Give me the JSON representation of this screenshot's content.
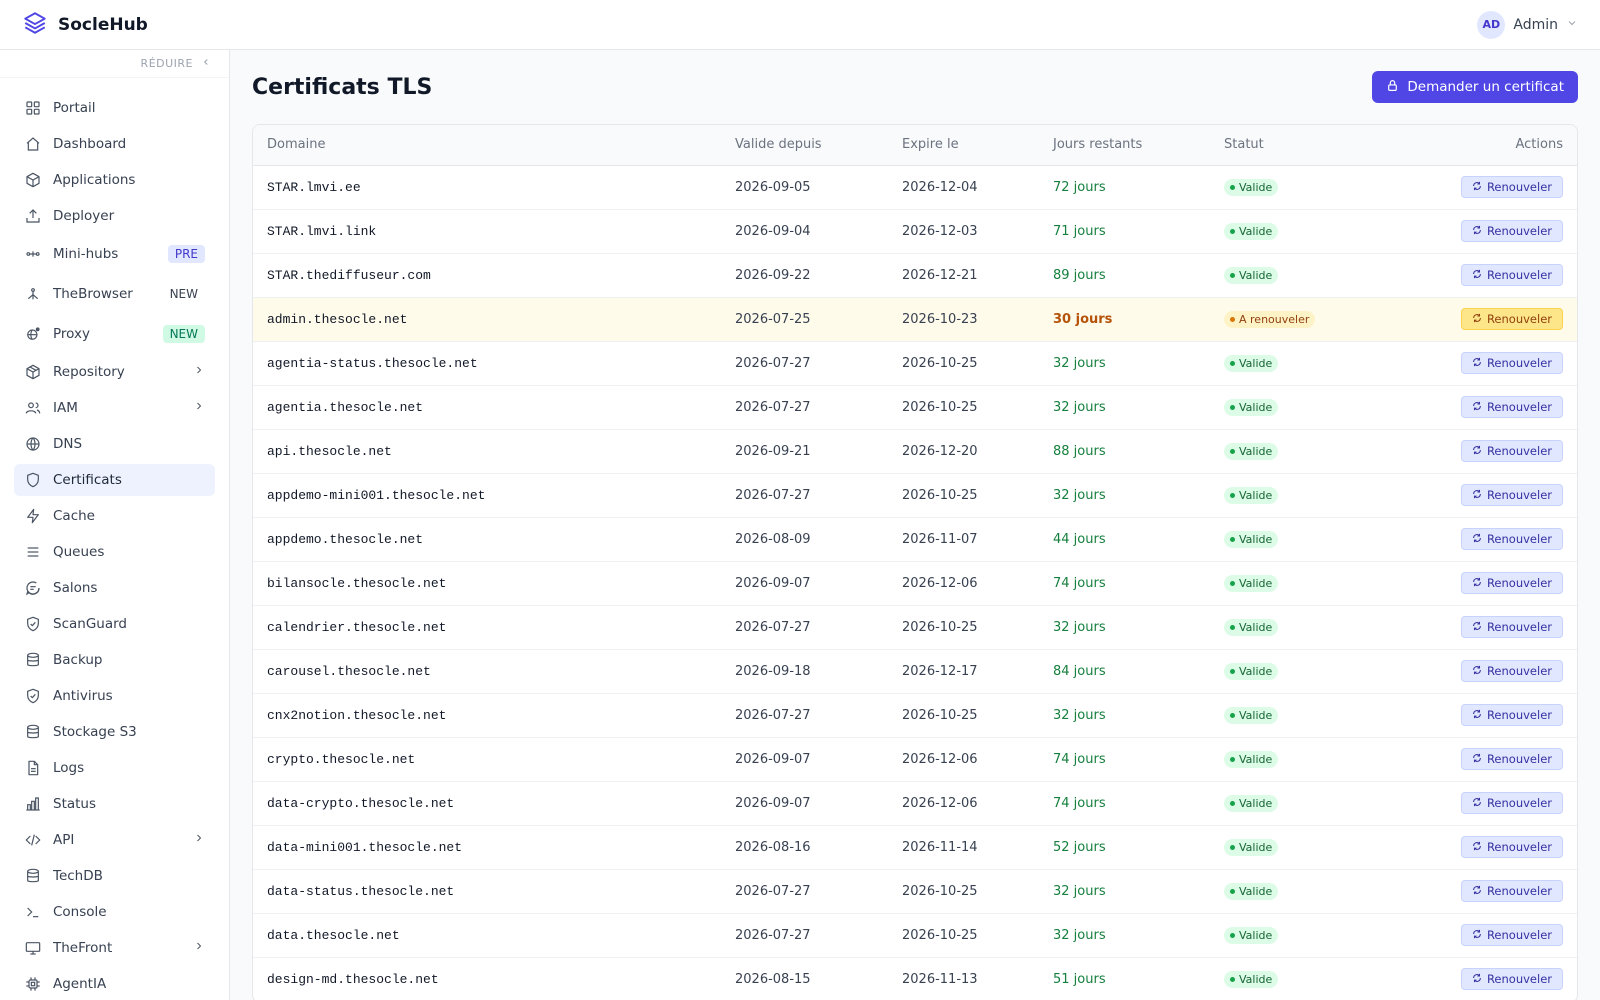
{
  "header": {
    "brand": "SocleHub",
    "user_initials": "AD",
    "user_name": "Admin"
  },
  "sidebar": {
    "collapse_label": "RÉDUIRE",
    "items": [
      {
        "label": "Portail",
        "icon": "grid-icon"
      },
      {
        "label": "Dashboard",
        "icon": "home-icon"
      },
      {
        "label": "Applications",
        "icon": "cube-icon"
      },
      {
        "label": "Deployer",
        "icon": "upload-icon"
      },
      {
        "label": "Mini-hubs",
        "icon": "hub-icon",
        "badge": "PRE"
      },
      {
        "label": "TheBrowser",
        "icon": "network-icon",
        "badge": "NEW"
      },
      {
        "label": "Proxy",
        "icon": "proxy-icon",
        "badge": "NEW"
      },
      {
        "label": "Repository",
        "icon": "package-icon"
      },
      {
        "label": "IAM",
        "icon": "users-icon"
      },
      {
        "label": "DNS",
        "icon": "globe-icon"
      },
      {
        "label": "Certificats",
        "icon": "shield-icon"
      },
      {
        "label": "Cache",
        "icon": "bolt-icon"
      },
      {
        "label": "Queues",
        "icon": "list-icon"
      },
      {
        "label": "Salons",
        "icon": "chat-icon"
      },
      {
        "label": "ScanGuard",
        "icon": "shield-check-icon"
      },
      {
        "label": "Backup",
        "icon": "database-icon"
      },
      {
        "label": "Antivirus",
        "icon": "shield-check-icon"
      },
      {
        "label": "Stockage S3",
        "icon": "database-icon"
      },
      {
        "label": "Logs",
        "icon": "file-icon"
      },
      {
        "label": "Status",
        "icon": "bar-chart-icon"
      },
      {
        "label": "API",
        "icon": "code-icon"
      },
      {
        "label": "TechDB",
        "icon": "database-icon"
      },
      {
        "label": "Console",
        "icon": "terminal-icon"
      },
      {
        "label": "TheFront",
        "icon": "monitor-icon"
      },
      {
        "label": "AgentIA",
        "icon": "cpu-icon"
      }
    ]
  },
  "page": {
    "title": "Certificats TLS",
    "request_button": "Demander un certificat"
  },
  "table": {
    "columns": [
      "Domaine",
      "Valide depuis",
      "Expire le",
      "Jours restants",
      "Statut",
      "Actions"
    ],
    "action_label": "Renouveler",
    "rows": [
      {
        "domain": "STAR.lmvi.ee",
        "from": "2026-09-05",
        "to": "2026-12-04",
        "days": "72 jours",
        "status": "Valide"
      },
      {
        "domain": "STAR.lmvi.link",
        "from": "2026-09-04",
        "to": "2026-12-03",
        "days": "71 jours",
        "status": "Valide"
      },
      {
        "domain": "STAR.thediffuseur.com",
        "from": "2026-09-22",
        "to": "2026-12-21",
        "days": "89 jours",
        "status": "Valide"
      },
      {
        "domain": "admin.thesocle.net",
        "from": "2026-07-25",
        "to": "2026-10-23",
        "days": "30 jours",
        "status": "A renouveler"
      },
      {
        "domain": "agentia-status.thesocle.net",
        "from": "2026-07-27",
        "to": "2026-10-25",
        "days": "32 jours",
        "status": "Valide"
      },
      {
        "domain": "agentia.thesocle.net",
        "from": "2026-07-27",
        "to": "2026-10-25",
        "days": "32 jours",
        "status": "Valide"
      },
      {
        "domain": "api.thesocle.net",
        "from": "2026-09-21",
        "to": "2026-12-20",
        "days": "88 jours",
        "status": "Valide"
      },
      {
        "domain": "appdemo-mini001.thesocle.net",
        "from": "2026-07-27",
        "to": "2026-10-25",
        "days": "32 jours",
        "status": "Valide"
      },
      {
        "domain": "appdemo.thesocle.net",
        "from": "2026-08-09",
        "to": "2026-11-07",
        "days": "44 jours",
        "status": "Valide"
      },
      {
        "domain": "bilansocle.thesocle.net",
        "from": "2026-09-07",
        "to": "2026-12-06",
        "days": "74 jours",
        "status": "Valide"
      },
      {
        "domain": "calendrier.thesocle.net",
        "from": "2026-07-27",
        "to": "2026-10-25",
        "days": "32 jours",
        "status": "Valide"
      },
      {
        "domain": "carousel.thesocle.net",
        "from": "2026-09-18",
        "to": "2026-12-17",
        "days": "84 jours",
        "status": "Valide"
      },
      {
        "domain": "cnx2notion.thesocle.net",
        "from": "2026-07-27",
        "to": "2026-10-25",
        "days": "32 jours",
        "status": "Valide"
      },
      {
        "domain": "crypto.thesocle.net",
        "from": "2026-09-07",
        "to": "2026-12-06",
        "days": "74 jours",
        "status": "Valide"
      },
      {
        "domain": "data-crypto.thesocle.net",
        "from": "2026-09-07",
        "to": "2026-12-06",
        "days": "74 jours",
        "status": "Valide"
      },
      {
        "domain": "data-mini001.thesocle.net",
        "from": "2026-08-16",
        "to": "2026-11-14",
        "days": "52 jours",
        "status": "Valide"
      },
      {
        "domain": "data-status.thesocle.net",
        "from": "2026-07-27",
        "to": "2026-10-25",
        "days": "32 jours",
        "status": "Valide"
      },
      {
        "domain": "data.thesocle.net",
        "from": "2026-07-27",
        "to": "2026-10-25",
        "days": "32 jours",
        "status": "Valide"
      },
      {
        "domain": "design-md.thesocle.net",
        "from": "2026-08-15",
        "to": "2026-11-13",
        "days": "51 jours",
        "status": "Valide"
      }
    ]
  },
  "colors": {
    "accent": "#4f46e5",
    "valid": "#16a34a",
    "warning": "#d97706"
  }
}
